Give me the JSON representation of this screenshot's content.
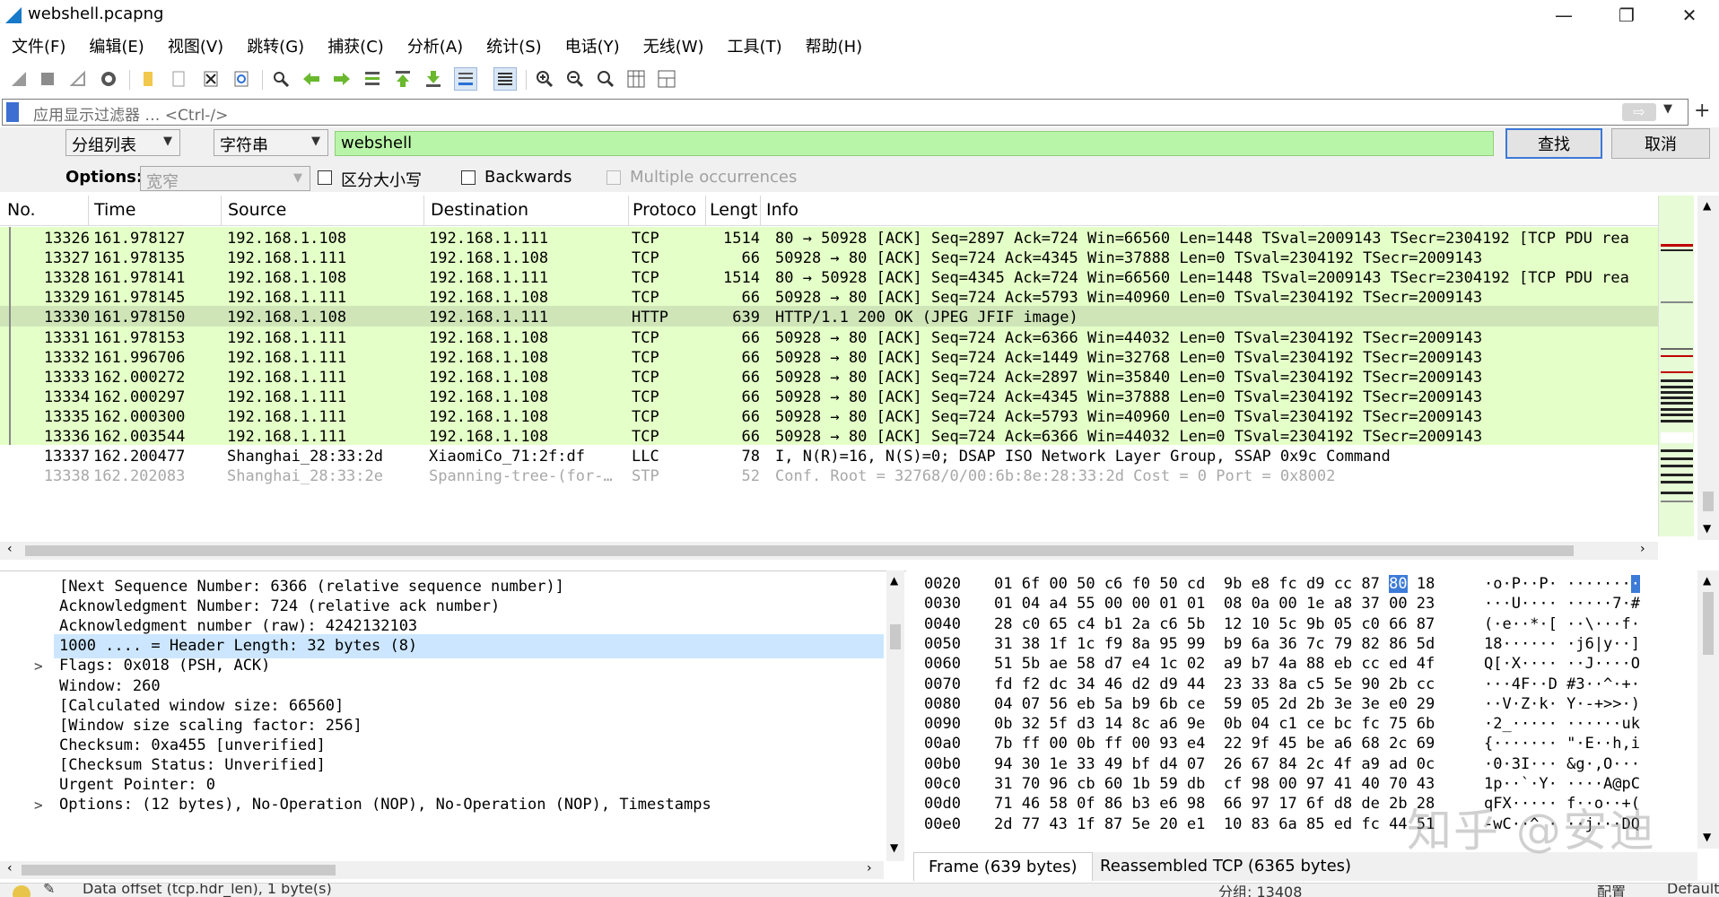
{
  "window": {
    "title": "webshell.pcapng",
    "minimize_glyph": "—",
    "maximize_glyph": "❐",
    "close_glyph": "✕"
  },
  "menu": [
    "文件(F)",
    "编辑(E)",
    "视图(V)",
    "跳转(G)",
    "捕获(C)",
    "分析(A)",
    "统计(S)",
    "电话(Y)",
    "无线(W)",
    "工具(T)",
    "帮助(H)"
  ],
  "toolbar_icons": [
    "start-capture-icon",
    "stop-capture-icon",
    "restart-capture-icon",
    "capture-options-icon",
    "open-file-icon",
    "save-file-icon",
    "close-file-icon",
    "reload-file-icon",
    "find-packet-icon",
    "go-back-icon",
    "go-forward-icon",
    "go-to-packet-icon",
    "go-first-icon",
    "go-last-icon",
    "autoscroll-icon",
    "colorize-icon",
    "zoom-in-icon",
    "zoom-out-icon",
    "zoom-normal-icon",
    "resize-columns-icon",
    "layout-icon"
  ],
  "display_filter": {
    "placeholder": "应用显示过滤器 … <Ctrl-/>",
    "apply_glyph": "⇨",
    "plus_glyph": "+"
  },
  "find": {
    "search_in": "分组列表",
    "search_type": "字符串",
    "search_value": "webshell",
    "find_button": "查找",
    "cancel_button": "取消",
    "options_label": "Options:",
    "charset": "宽窄",
    "case_sensitive": "区分大小写",
    "backwards": "Backwards",
    "multiple_occurrences": "Multiple occurrences"
  },
  "packet_list": {
    "columns": [
      "No.",
      "Time",
      "Source",
      "Destination",
      "Protoco",
      "Lengt",
      "Info"
    ],
    "rows": [
      {
        "no": "13326",
        "time": "161.978127",
        "src": "192.168.1.108",
        "dst": "192.168.1.111",
        "proto": "TCP",
        "len": "1514",
        "info": "80 → 50928 [ACK] Seq=2897 Ack=724 Win=66560 Len=1448 TSval=2009143 TSecr=2304192 [TCP PDU rea",
        "style": "green"
      },
      {
        "no": "13327",
        "time": "161.978135",
        "src": "192.168.1.111",
        "dst": "192.168.1.108",
        "proto": "TCP",
        "len": "66",
        "info": "50928 → 80 [ACK] Seq=724 Ack=4345 Win=37888 Len=0 TSval=2304192 TSecr=2009143",
        "style": "green"
      },
      {
        "no": "13328",
        "time": "161.978141",
        "src": "192.168.1.108",
        "dst": "192.168.1.111",
        "proto": "TCP",
        "len": "1514",
        "info": "80 → 50928 [ACK] Seq=4345 Ack=724 Win=66560 Len=1448 TSval=2009143 TSecr=2304192 [TCP PDU rea",
        "style": "green"
      },
      {
        "no": "13329",
        "time": "161.978145",
        "src": "192.168.1.111",
        "dst": "192.168.1.108",
        "proto": "TCP",
        "len": "66",
        "info": "50928 → 80 [ACK] Seq=724 Ack=5793 Win=40960 Len=0 TSval=2304192 TSecr=2009143",
        "style": "green"
      },
      {
        "no": "13330",
        "time": "161.978150",
        "src": "192.168.1.108",
        "dst": "192.168.1.111",
        "proto": "HTTP",
        "len": "639",
        "info": "HTTP/1.1 200 OK  (JPEG JFIF image)",
        "style": "selected"
      },
      {
        "no": "13331",
        "time": "161.978153",
        "src": "192.168.1.111",
        "dst": "192.168.1.108",
        "proto": "TCP",
        "len": "66",
        "info": "50928 → 80 [ACK] Seq=724 Ack=6366 Win=44032 Len=0 TSval=2304192 TSecr=2009143",
        "style": "green"
      },
      {
        "no": "13332",
        "time": "161.996706",
        "src": "192.168.1.111",
        "dst": "192.168.1.108",
        "proto": "TCP",
        "len": "66",
        "info": "50928 → 80 [ACK] Seq=724 Ack=1449 Win=32768 Len=0 TSval=2304192 TSecr=2009143",
        "style": "green"
      },
      {
        "no": "13333",
        "time": "162.000272",
        "src": "192.168.1.111",
        "dst": "192.168.1.108",
        "proto": "TCP",
        "len": "66",
        "info": "50928 → 80 [ACK] Seq=724 Ack=2897 Win=35840 Len=0 TSval=2304192 TSecr=2009143",
        "style": "green"
      },
      {
        "no": "13334",
        "time": "162.000297",
        "src": "192.168.1.111",
        "dst": "192.168.1.108",
        "proto": "TCP",
        "len": "66",
        "info": "50928 → 80 [ACK] Seq=724 Ack=4345 Win=37888 Len=0 TSval=2304192 TSecr=2009143",
        "style": "green"
      },
      {
        "no": "13335",
        "time": "162.000300",
        "src": "192.168.1.111",
        "dst": "192.168.1.108",
        "proto": "TCP",
        "len": "66",
        "info": "50928 → 80 [ACK] Seq=724 Ack=5793 Win=40960 Len=0 TSval=2304192 TSecr=2009143",
        "style": "green"
      },
      {
        "no": "13336",
        "time": "162.003544",
        "src": "192.168.1.111",
        "dst": "192.168.1.108",
        "proto": "TCP",
        "len": "66",
        "info": "50928 → 80 [ACK] Seq=724 Ack=6366 Win=44032 Len=0 TSval=2304192 TSecr=2009143",
        "style": "green"
      },
      {
        "no": "13337",
        "time": "162.200477",
        "src": "Shanghai_28:33:2d",
        "dst": "XiaomiCo_71:2f:df",
        "proto": "LLC",
        "len": "78",
        "info": "I, N(R)=16, N(S)=0; DSAP ISO Network Layer Group, SSAP 0x9c Command",
        "style": "white"
      },
      {
        "no": "13338",
        "time": "162.202083",
        "src": "Shanghai_28:33:2e",
        "dst": "Spanning-tree-(for-…",
        "proto": "STP",
        "len": "52",
        "info": "Conf. Root = 32768/0/00:6b:8e:28:33:2d  Cost = 0  Port = 0x8002",
        "style": "faded"
      }
    ]
  },
  "details": {
    "rows": [
      {
        "text": "[Next Sequence Number: 6366    (relative sequence number)]",
        "expander": ""
      },
      {
        "text": "Acknowledgment Number: 724    (relative ack number)",
        "expander": ""
      },
      {
        "text": "Acknowledgment number (raw): 4242132103",
        "expander": ""
      },
      {
        "text": "1000 .... = Header Length: 32 bytes (8)",
        "expander": "",
        "selected": true
      },
      {
        "text": "Flags: 0x018 (PSH, ACK)",
        "expander": ">"
      },
      {
        "text": "Window: 260",
        "expander": ""
      },
      {
        "text": "[Calculated window size: 66560]",
        "expander": ""
      },
      {
        "text": "[Window size scaling factor: 256]",
        "expander": ""
      },
      {
        "text": "Checksum: 0xa455 [unverified]",
        "expander": ""
      },
      {
        "text": "[Checksum Status: Unverified]",
        "expander": ""
      },
      {
        "text": "Urgent Pointer: 0",
        "expander": ""
      },
      {
        "text": "Options: (12 bytes), No-Operation (NOP), No-Operation (NOP), Timestamps",
        "expander": ">"
      }
    ]
  },
  "bytes": {
    "rows": [
      {
        "off": "0020",
        "hex_a": "01 6f 00 50 c6 f0 50 cd  9b e8 fc d9 cc 87 ",
        "hex_hl": "80",
        "hex_b": " 18",
        "ascii": "·o·P··P· ·······",
        "ascii_hl": "·"
      },
      {
        "off": "0030",
        "hex_a": "01 04 a4 55 00 00 01 01  08 0a 00 1e a8 37 00 23",
        "hex_hl": "",
        "hex_b": "",
        "ascii": "···U···· ·····7·#",
        "ascii_hl": ""
      },
      {
        "off": "0040",
        "hex_a": "28 c0 65 c4 b1 2a c6 5b  12 10 5c 9b 05 c0 66 87",
        "hex_hl": "",
        "hex_b": "",
        "ascii": "(·e··*·[ ··\\···f·",
        "ascii_hl": ""
      },
      {
        "off": "0050",
        "hex_a": "31 38 1f 1c f9 8a 95 99  b9 6a 36 7c 79 82 86 5d",
        "hex_hl": "",
        "hex_b": "",
        "ascii": "18······ ·j6|y··]",
        "ascii_hl": ""
      },
      {
        "off": "0060",
        "hex_a": "51 5b ae 58 d7 e4 1c 02  a9 b7 4a 88 eb cc ed 4f",
        "hex_hl": "",
        "hex_b": "",
        "ascii": "Q[·X···· ··J····O",
        "ascii_hl": ""
      },
      {
        "off": "0070",
        "hex_a": "fd f2 dc 34 46 d2 d9 44  23 33 8a c5 5e 90 2b cc",
        "hex_hl": "",
        "hex_b": "",
        "ascii": "···4F··D #3··^·+·",
        "ascii_hl": ""
      },
      {
        "off": "0080",
        "hex_a": "04 07 56 eb 5a b9 6b ce  59 05 2d 2b 3e 3e e0 29",
        "hex_hl": "",
        "hex_b": "",
        "ascii": "··V·Z·k· Y·-+>>·)",
        "ascii_hl": ""
      },
      {
        "off": "0090",
        "hex_a": "0b 32 5f d3 14 8c a6 9e  0b 04 c1 ce bc fc 75 6b",
        "hex_hl": "",
        "hex_b": "",
        "ascii": "·2_····· ······uk",
        "ascii_hl": ""
      },
      {
        "off": "00a0",
        "hex_a": "7b ff 00 0b ff 00 93 e4  22 9f 45 be a6 68 2c 69",
        "hex_hl": "",
        "hex_b": "",
        "ascii": "{······· \"·E··h,i",
        "ascii_hl": ""
      },
      {
        "off": "00b0",
        "hex_a": "94 30 1e 33 49 bf d4 07  26 67 84 2c 4f a9 ad 0c",
        "hex_hl": "",
        "hex_b": "",
        "ascii": "·0·3I··· &g·,O···",
        "ascii_hl": ""
      },
      {
        "off": "00c0",
        "hex_a": "31 70 96 cb 60 1b 59 db  cf 98 00 97 41 40 70 43",
        "hex_hl": "",
        "hex_b": "",
        "ascii": "1p··`·Y· ····A@pC",
        "ascii_hl": ""
      },
      {
        "off": "00d0",
        "hex_a": "71 46 58 0f 86 b3 e6 98  66 97 17 6f d8 de 2b 28",
        "hex_hl": "",
        "hex_b": "",
        "ascii": "qFX····· f··o··+(",
        "ascii_hl": ""
      },
      {
        "off": "00e0",
        "hex_a": "2d 77 43 1f 87 5e 20 e1  10 83 6a 85 ed fc 44 51",
        "hex_hl": "",
        "hex_b": "",
        "ascii": "-wC··^ · ··j···DQ",
        "ascii_hl": ""
      }
    ],
    "tabs": [
      "Frame (639 bytes)",
      "Reassembled TCP (6365 bytes)"
    ]
  },
  "watermark": "知乎 @安迪",
  "status": {
    "left": "Data offset (tcp.hdr_len), 1 byte(s)",
    "middle": "分组: 13408",
    "right_a": "配置",
    "right_b": "Default"
  },
  "colors": {
    "row_green": "#e4ffc7",
    "row_selected": "#cfe5b8",
    "search_field": "#b9f5a8",
    "detail_selected": "#cce6ff",
    "byte_highlight": "#3c7bd8"
  }
}
